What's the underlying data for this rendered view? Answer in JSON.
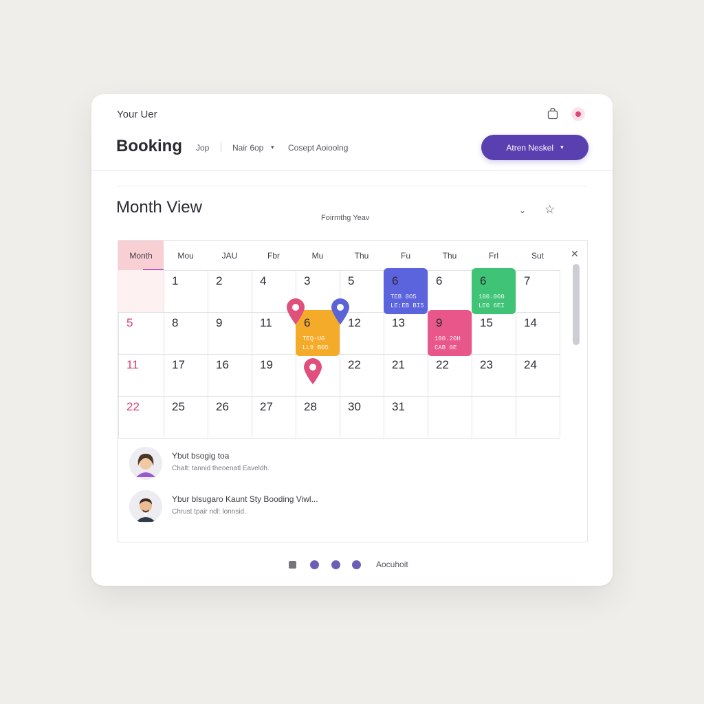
{
  "header": {
    "user_label": "Your Uer",
    "title": "Booking",
    "nav": [
      "Jop",
      "Nair 6op",
      "Cosept Aoioolng"
    ],
    "cta_label": "Atren Neskel"
  },
  "calendar": {
    "view_title": "Month View",
    "view_subtitle": "Foirmthg Yeav",
    "tab_label": "Month",
    "day_headers": [
      "Mou",
      "JAU",
      "Fbr",
      "Mu",
      "Thu",
      "Fu",
      "Thu",
      "Frl",
      "Sut"
    ],
    "weeks": [
      [
        "",
        "1",
        "2",
        "4",
        "3",
        "5",
        "6",
        "6",
        "6",
        "7"
      ],
      [
        "5",
        "8",
        "9",
        "11",
        "6",
        "12",
        "13",
        "9",
        "15",
        "14"
      ],
      [
        "11",
        "17",
        "16",
        "19",
        "",
        "22",
        "21",
        "22",
        "23",
        "24"
      ],
      [
        "22",
        "25",
        "26",
        "27",
        "28",
        "30",
        "31",
        "",
        "",
        ""
      ]
    ],
    "events": [
      {
        "color": "#5b63dd",
        "line1": "TEB 0O5",
        "line2": "LE:EB BI5"
      },
      {
        "color": "#3fc477",
        "line1": "100.000",
        "line2": "LE0 6EI"
      },
      {
        "color": "#f5ab2a",
        "line1": "TEQ-UG",
        "line2": "LL9 B05"
      },
      {
        "color": "#e8568a",
        "line1": "100.20H",
        "line2": "CAB 0E"
      }
    ],
    "pin_colors": {
      "pink": "#e0507c",
      "blue": "#5a64d6"
    }
  },
  "bookings": [
    {
      "title": "Ybut bsogig toa",
      "subtitle": "Chalt: tannid theoenatl Eaveldh."
    },
    {
      "title": "Ybur blsugaro Kaunt Sty Booding Viwl...",
      "subtitle": "Chrust tpair ndl: lonnsid."
    }
  ],
  "pager": {
    "label": "Aocuhoit"
  },
  "icons": [
    "bag-icon",
    "bell-icon",
    "chevron-down-icon",
    "star-icon",
    "close-icon",
    "pin-icon"
  ]
}
